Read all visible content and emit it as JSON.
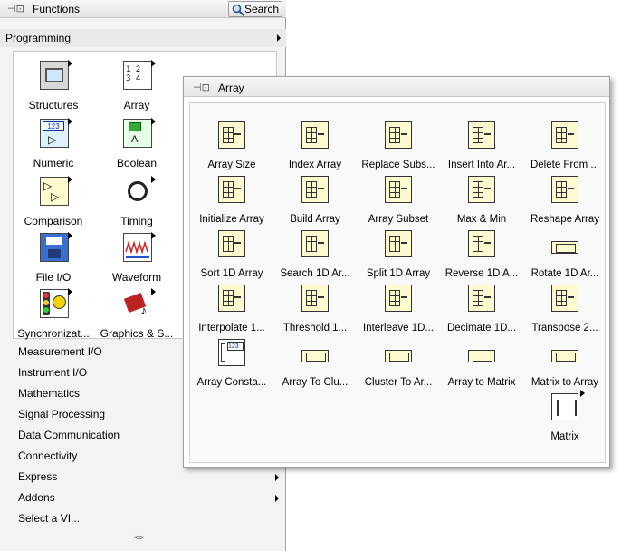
{
  "functions": {
    "title": "Functions",
    "search_label": "Search",
    "category": "Programming",
    "items": [
      {
        "label": "Structures"
      },
      {
        "label": "Array"
      },
      {
        "label": "Numeric"
      },
      {
        "label": "Boolean"
      },
      {
        "label": "Comparison"
      },
      {
        "label": "Timing"
      },
      {
        "label": "File I/O"
      },
      {
        "label": "Waveform"
      },
      {
        "label": "Synchronizat..."
      },
      {
        "label": "Graphics & S..."
      }
    ],
    "categories": [
      {
        "label": "Measurement I/O"
      },
      {
        "label": "Instrument I/O"
      },
      {
        "label": "Mathematics"
      },
      {
        "label": "Signal Processing"
      },
      {
        "label": "Data Communication"
      },
      {
        "label": "Connectivity"
      },
      {
        "label": "Express"
      },
      {
        "label": "Addons"
      },
      {
        "label": "Select a VI..."
      }
    ],
    "numeric_icon_text": "123",
    "array_icon_text": "1 2\n3 4"
  },
  "array_palette": {
    "title": "Array",
    "items": [
      {
        "label": "Array Size"
      },
      {
        "label": "Index Array"
      },
      {
        "label": "Replace Subs..."
      },
      {
        "label": "Insert Into Ar..."
      },
      {
        "label": "Delete From ..."
      },
      {
        "label": "Initialize Array"
      },
      {
        "label": "Build Array"
      },
      {
        "label": "Array Subset"
      },
      {
        "label": "Max & Min"
      },
      {
        "label": "Reshape Array"
      },
      {
        "label": "Sort 1D Array"
      },
      {
        "label": "Search 1D Ar..."
      },
      {
        "label": "Split 1D Array"
      },
      {
        "label": "Reverse 1D A..."
      },
      {
        "label": "Rotate 1D Ar..."
      },
      {
        "label": "Interpolate 1..."
      },
      {
        "label": "Threshold 1..."
      },
      {
        "label": "Interleave 1D..."
      },
      {
        "label": "Decimate 1D..."
      },
      {
        "label": "Transpose 2..."
      },
      {
        "label": "Array Consta..."
      },
      {
        "label": "Array To Clu..."
      },
      {
        "label": "Cluster To Ar..."
      },
      {
        "label": "Array to Matrix"
      },
      {
        "label": "Matrix to Array"
      },
      {
        "label": "Matrix"
      }
    ],
    "array_constant_icon_text": "123"
  }
}
